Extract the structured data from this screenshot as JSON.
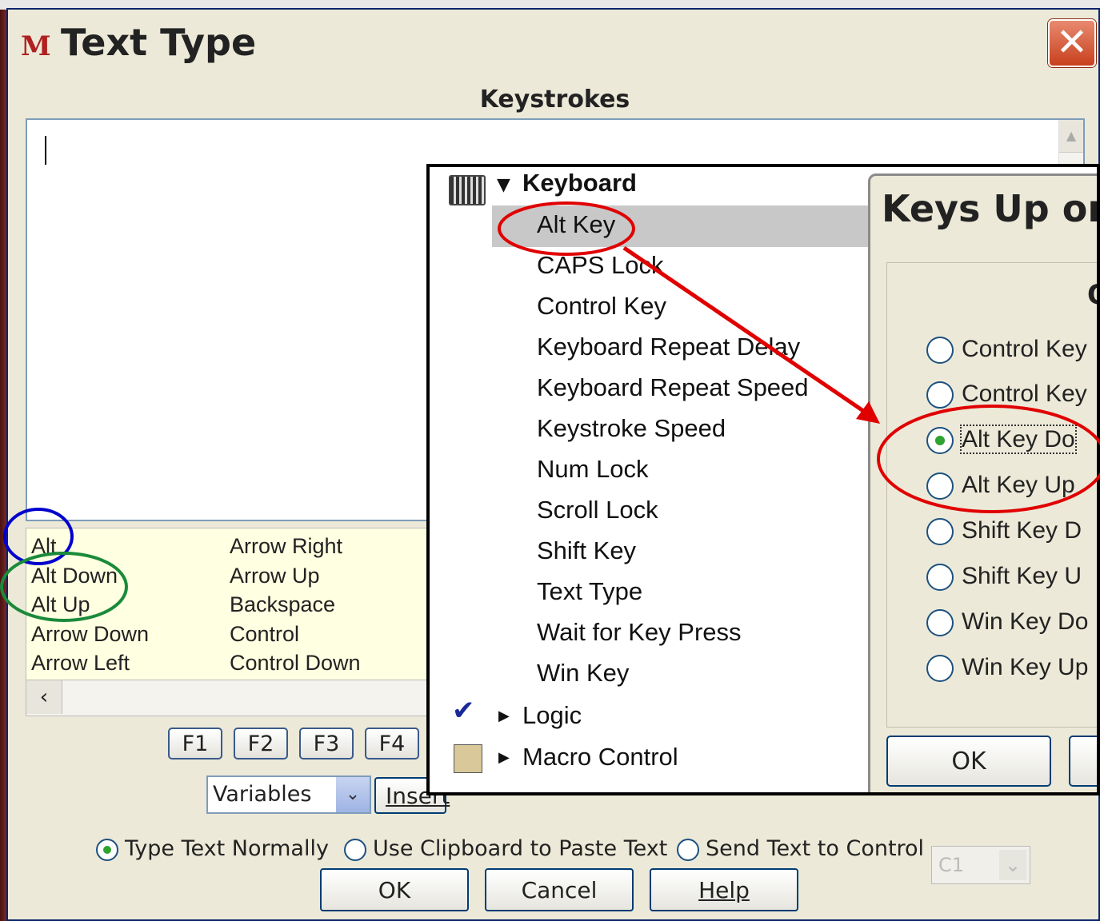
{
  "window": {
    "title": "Text Type",
    "app_icon": "M",
    "close_label": "✕"
  },
  "keystrokes": {
    "label": "Keystrokes",
    "value": ""
  },
  "key_list": {
    "col1": [
      "Alt",
      "Alt Down",
      "Alt Up",
      "Arrow Down",
      "Arrow Left"
    ],
    "col2": [
      "Arrow Right",
      "Arrow Up",
      "Backspace",
      "Control",
      "Control Down"
    ]
  },
  "function_keys": [
    "F1",
    "F2",
    "F3",
    "F4"
  ],
  "variables_combo": {
    "value": "Variables"
  },
  "insert_label": "Insert",
  "type_options": {
    "normal": "Type Text Normally",
    "clipboard": "Use Clipboard to Paste Text",
    "control": "Send Text to Control",
    "control_combo": "C1",
    "selected": "normal"
  },
  "buttons": {
    "ok": "OK",
    "cancel": "Cancel",
    "help": "Help"
  },
  "popup_menu": {
    "group_label": "Keyboard",
    "items": [
      "Alt Key",
      "CAPS Lock",
      "Control Key",
      "Keyboard Repeat Delay",
      "Keyboard Repeat Speed",
      "Keystroke Speed",
      "Num Lock",
      "Scroll Lock",
      "Shift Key",
      "Text Type",
      "Wait for Key Press",
      "Win Key"
    ],
    "selected": "Alt Key",
    "other_groups": [
      "Logic",
      "Macro Control"
    ]
  },
  "keys_dialog": {
    "title": "Keys Up or",
    "group_header": "O",
    "options": [
      "Control Key",
      "Control Key",
      "Alt Key Do",
      "Alt Key Up",
      "Shift Key D",
      "Shift Key U",
      "Win Key Do",
      "Win Key Up"
    ],
    "selected_index": 2,
    "ok_label": "OK"
  },
  "annotations": {
    "blue": "#0000cc",
    "green": "#1a8a3a",
    "red": "#e00000"
  }
}
